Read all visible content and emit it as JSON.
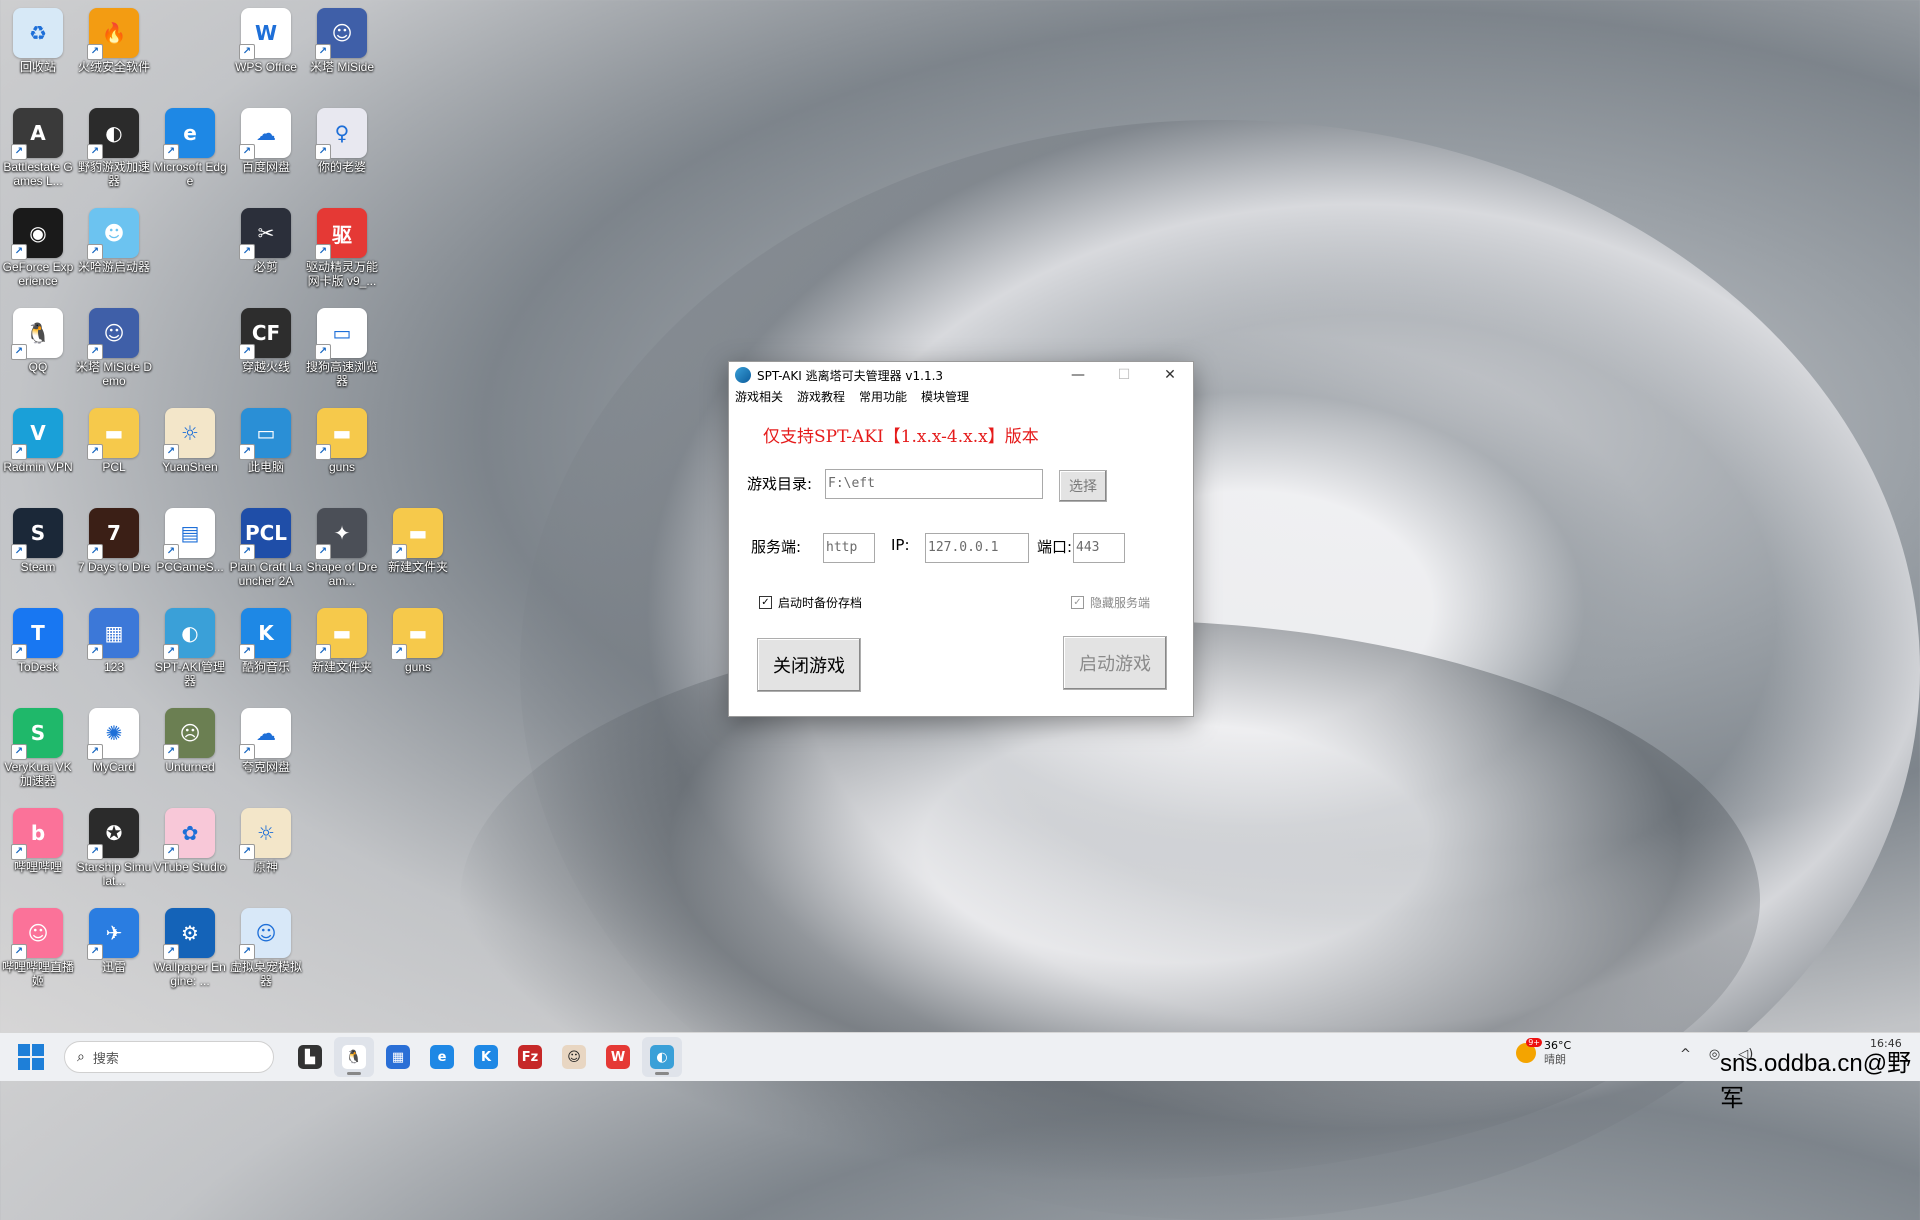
{
  "desktop_icons": [
    {
      "label": "回收站",
      "icon": "recycle-bin-icon",
      "bg": "#d7e9f7",
      "glyph": "♻"
    },
    {
      "label": "火绒安全软件",
      "icon": "huorong-icon",
      "bg": "#f39c12",
      "glyph": "🔥"
    },
    {
      "label": "WPS Office",
      "icon": "wps-icon",
      "bg": "#ffffff",
      "glyph": "W"
    },
    {
      "label": "米塔 MiSide",
      "icon": "miside-icon",
      "bg": "#3f5fa8",
      "glyph": "☺"
    },
    {
      "label": "Battlestate Games L...",
      "icon": "battlestate-icon",
      "bg": "#3a3a3a",
      "glyph": "A"
    },
    {
      "label": "野豹游戏加速器",
      "icon": "yebao-icon",
      "bg": "#2b2b2b",
      "glyph": "◐"
    },
    {
      "label": "Microsoft Edge",
      "icon": "edge-icon",
      "bg": "#1e88e5",
      "glyph": "e"
    },
    {
      "label": "百度网盘",
      "icon": "baidu-pan-icon",
      "bg": "#ffffff",
      "glyph": "☁"
    },
    {
      "label": "你的老婆",
      "icon": "wife-icon",
      "bg": "#e8e8f0",
      "glyph": "♀"
    },
    {
      "label": "GeForce Experience",
      "icon": "geforce-icon",
      "bg": "#1a1a1a",
      "glyph": "◉"
    },
    {
      "label": "米哈游启动器",
      "icon": "mihoyo-icon",
      "bg": "#6cc3f0",
      "glyph": "☻"
    },
    {
      "label": "必剪",
      "icon": "bijian-icon",
      "bg": "#2b2f3a",
      "glyph": "✂"
    },
    {
      "label": "驱动精灵万能网卡版 v9_...",
      "icon": "driver-icon",
      "bg": "#e53935",
      "glyph": "驱"
    },
    {
      "label": "QQ",
      "icon": "qq-icon",
      "bg": "#ffffff",
      "glyph": "🐧"
    },
    {
      "label": "米塔 MiSide Demo",
      "icon": "miside-demo-icon",
      "bg": "#3f5fa8",
      "glyph": "☺"
    },
    {
      "label": "穿越火线",
      "icon": "cf-icon",
      "bg": "#2d2d2d",
      "glyph": "CF"
    },
    {
      "label": "搜狗高速浏览器",
      "icon": "file-icon",
      "bg": "#ffffff",
      "glyph": "▭"
    },
    {
      "label": "Radmin VPN",
      "icon": "radmin-icon",
      "bg": "#1aa0d8",
      "glyph": "V"
    },
    {
      "label": "PCL",
      "icon": "folder-icon",
      "bg": "#f6c94b",
      "glyph": "▬"
    },
    {
      "label": "YuanShen",
      "icon": "yuanshen-icon",
      "bg": "#f3e6c9",
      "glyph": "☼"
    },
    {
      "label": "此电脑",
      "icon": "computer-icon",
      "bg": "#2a8fd6",
      "glyph": "▭"
    },
    {
      "label": "guns",
      "icon": "folder-icon",
      "bg": "#f6c94b",
      "glyph": "▬"
    },
    {
      "label": "Steam",
      "icon": "steam-icon",
      "bg": "#1b2838",
      "glyph": "S"
    },
    {
      "label": "7 Days to Die",
      "icon": "7days-icon",
      "bg": "#3b1f16",
      "glyph": "7"
    },
    {
      "label": "PCGameS...",
      "icon": "file-icon",
      "bg": "#ffffff",
      "glyph": "▤"
    },
    {
      "label": "Plain Craft Launcher 2A",
      "icon": "pcl-icon",
      "bg": "#1f4ea8",
      "glyph": "PCL"
    },
    {
      "label": "Shape of Dream...",
      "icon": "shape-icon",
      "bg": "#4b4f57",
      "glyph": "✦"
    },
    {
      "label": "新建文件夹",
      "icon": "folder-icon",
      "bg": "#f6c94b",
      "glyph": "▬"
    },
    {
      "label": "ToDesk",
      "icon": "todesk-icon",
      "bg": "#1877f2",
      "glyph": "T"
    },
    {
      "label": "123",
      "icon": "cube-icon",
      "bg": "#3c78d8",
      "glyph": "▦"
    },
    {
      "label": "SPT-AKI管理器",
      "icon": "spt-icon",
      "bg": "#3aa0d8",
      "glyph": "◐"
    },
    {
      "label": "酷狗音乐",
      "icon": "kugou-icon",
      "bg": "#1e88e5",
      "glyph": "K"
    },
    {
      "label": "新建文件夹",
      "icon": "folder-icon",
      "bg": "#f6c94b",
      "glyph": "▬"
    },
    {
      "label": "guns",
      "icon": "folder-icon",
      "bg": "#f6c94b",
      "glyph": "▬"
    },
    {
      "label": "VeryKuai VK加速器",
      "icon": "verykuai-icon",
      "bg": "#1fb86a",
      "glyph": "S"
    },
    {
      "label": "MyCard",
      "icon": "mycard-icon",
      "bg": "#ffffff",
      "glyph": "✺"
    },
    {
      "label": "Unturned",
      "icon": "unturned-icon",
      "bg": "#6b7f52",
      "glyph": "☹"
    },
    {
      "label": "夸克网盘",
      "icon": "quark-icon",
      "bg": "#ffffff",
      "glyph": "☁"
    },
    {
      "label": "哔哩哔哩",
      "icon": "bilibili-icon",
      "bg": "#fb7299",
      "glyph": "b"
    },
    {
      "label": "Starship Simulat...",
      "icon": "starship-icon",
      "bg": "#2b2b2b",
      "glyph": "✪"
    },
    {
      "label": "VTube Studio",
      "icon": "vtube-icon",
      "bg": "#f8c8d8",
      "glyph": "✿"
    },
    {
      "label": "原神",
      "icon": "genshin-icon",
      "bg": "#f3e6c9",
      "glyph": "☼"
    },
    {
      "label": "哔哩哔哩直播姬",
      "icon": "bili-live-icon",
      "bg": "#fb7299",
      "glyph": "☺"
    },
    {
      "label": "迅雷",
      "icon": "xunlei-icon",
      "bg": "#2a7de1",
      "glyph": "✈"
    },
    {
      "label": "Wallpaper Engine: ...",
      "icon": "wallpaper-icon",
      "bg": "#1463b8",
      "glyph": "⚙"
    },
    {
      "label": "虚拟桌宠模拟器",
      "icon": "desktop-pet-icon",
      "bg": "#d8e8f8",
      "glyph": "☺"
    }
  ],
  "window": {
    "title": "SPT-AKI 逃离塔可夫管理器 v1.1.3",
    "minimize": "—",
    "maximize": "☐",
    "close": "✕",
    "menu": [
      "游戏相关",
      "游戏教程",
      "常用功能",
      "模块管理"
    ],
    "notice": "仅支持SPT-AKI【1.x.x-4.x.x】版本",
    "game_dir_label": "游戏目录:",
    "game_dir_value": "F:\\eft",
    "select_button": "选择",
    "server_label": "服务端:",
    "server_value": "http",
    "ip_label": "IP:",
    "ip_value": "127.0.0.1",
    "port_label": "端口:",
    "port_value": "443",
    "backup_checkbox": "启动时备份存档",
    "backup_checked": true,
    "hide_server_checkbox": "隐藏服务端",
    "hide_server_checked": true,
    "close_game_button": "关闭游戏",
    "start_game_button": "启动游戏"
  },
  "taskbar": {
    "search_placeholder": "搜索",
    "apps": [
      {
        "icon": "task-view-icon",
        "glyph": "▙",
        "bg": "#333333"
      },
      {
        "icon": "qq-icon",
        "glyph": "🐧",
        "bg": "#ffffff",
        "active": true
      },
      {
        "icon": "store-icon",
        "glyph": "▦",
        "bg": "#2a6fd6"
      },
      {
        "icon": "edge-icon",
        "glyph": "e",
        "bg": "#1e88e5"
      },
      {
        "icon": "kugou-icon",
        "glyph": "K",
        "bg": "#1e88e5"
      },
      {
        "icon": "filezilla-icon",
        "glyph": "Fz",
        "bg": "#c62828"
      },
      {
        "icon": "anime-app-icon",
        "glyph": "☺",
        "bg": "#e8d6c2"
      },
      {
        "icon": "wps-icon",
        "glyph": "W",
        "bg": "#e53935"
      },
      {
        "icon": "spt-icon",
        "glyph": "◐",
        "bg": "#3aa0d8",
        "active": true
      }
    ],
    "weather_badge": "9+",
    "temperature": "36°C",
    "weather": "晴朗",
    "tray_chevron": "^",
    "clock": "16:46"
  },
  "watermark": "sns.oddba.cn@野军"
}
